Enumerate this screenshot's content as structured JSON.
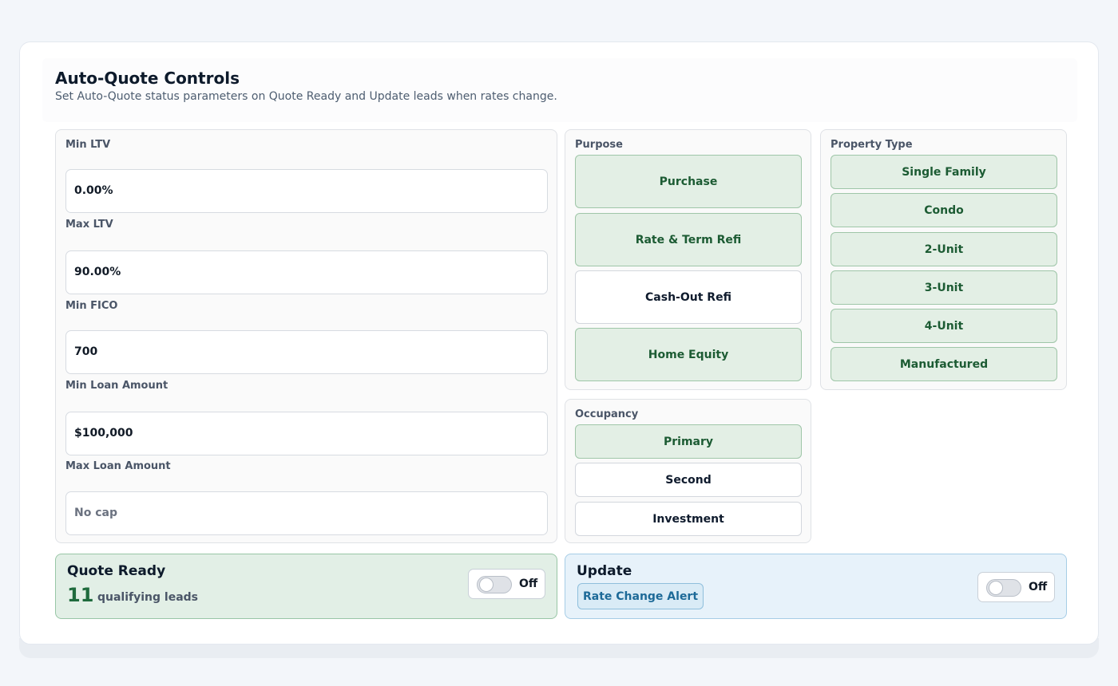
{
  "header": {
    "title": "Auto-Quote Controls",
    "subtitle": "Set Auto-Quote status parameters on Quote Ready and Update leads when rates change."
  },
  "filters": {
    "min_ltv": {
      "label": "Min LTV",
      "value": "0.00%"
    },
    "max_ltv": {
      "label": "Max LTV",
      "value": "90.00%"
    },
    "min_fico": {
      "label": "Min FICO",
      "value": "700"
    },
    "min_loan": {
      "label": "Min Loan Amount",
      "value": "$100,000"
    },
    "max_loan": {
      "label": "Max Loan Amount",
      "placeholder": "No cap"
    }
  },
  "purpose": {
    "label": "Purpose",
    "options": [
      {
        "label": "Purchase",
        "selected": true
      },
      {
        "label": "Rate & Term Refi",
        "selected": true
      },
      {
        "label": "Cash-Out Refi",
        "selected": false
      },
      {
        "label": "Home Equity",
        "selected": true
      }
    ]
  },
  "property_type": {
    "label": "Property Type",
    "options": [
      {
        "label": "Single Family",
        "selected": true
      },
      {
        "label": "Condo",
        "selected": true
      },
      {
        "label": "2-Unit",
        "selected": true
      },
      {
        "label": "3-Unit",
        "selected": true
      },
      {
        "label": "4-Unit",
        "selected": true
      },
      {
        "label": "Manufactured",
        "selected": true
      }
    ]
  },
  "occupancy": {
    "label": "Occupancy",
    "options": [
      {
        "label": "Primary",
        "selected": true
      },
      {
        "label": "Second",
        "selected": false
      },
      {
        "label": "Investment",
        "selected": false
      }
    ]
  },
  "quote_ready": {
    "title": "Quote Ready",
    "count": "11",
    "count_label": "qualifying leads",
    "toggle_state": "Off"
  },
  "update": {
    "title": "Update",
    "badge": "Rate Change Alert",
    "toggle_state": "Off"
  },
  "colors": {
    "selected_bg": "#e3efe5",
    "selected_text": "#1c5b33",
    "update_accent": "#1d6a98"
  }
}
